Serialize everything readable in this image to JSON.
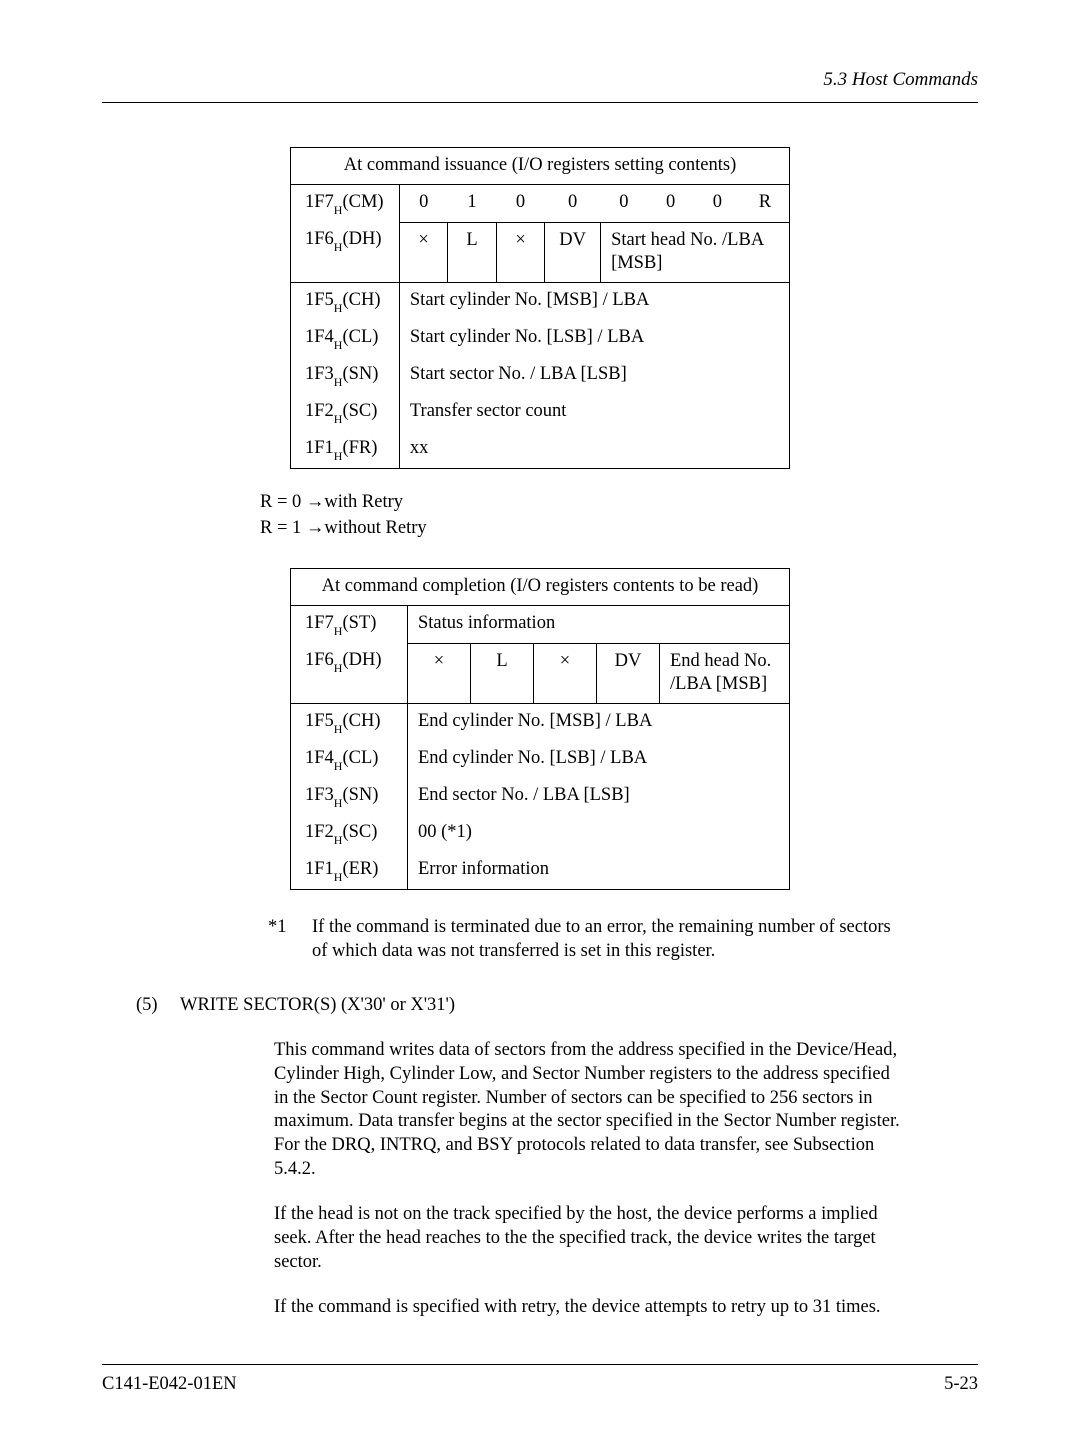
{
  "header": "5.3  Host Commands",
  "table1": {
    "caption": "At command issuance (I/O registers setting contents)",
    "rows": {
      "r1": {
        "reg": "1F7",
        "sub": "H",
        "name": "(CM)",
        "b": [
          "0",
          "1",
          "0",
          "0",
          "0",
          "0",
          "0",
          "R"
        ]
      },
      "r2": {
        "reg": "1F6",
        "sub": "H",
        "name": "(DH)",
        "c1": "×",
        "c2": "L",
        "c3": "×",
        "c4": "DV",
        "c5": "Start head No. /LBA [MSB]"
      },
      "r3": {
        "reg": "1F5",
        "sub": "H",
        "name": "(CH)",
        "val": "Start cylinder No. [MSB] / LBA"
      },
      "r4": {
        "reg": "1F4",
        "sub": "H",
        "name": "(CL)",
        "val": "Start cylinder No. [LSB] / LBA"
      },
      "r5": {
        "reg": "1F3",
        "sub": "H",
        "name": "(SN)",
        "val": "Start sector No. / LBA [LSB]"
      },
      "r6": {
        "reg": "1F2",
        "sub": "H",
        "name": "(SC)",
        "val": "Transfer sector count"
      },
      "r7": {
        "reg": "1F1",
        "sub": "H",
        "name": "(FR)",
        "val": "xx"
      }
    }
  },
  "notes": {
    "line1_a": "R = 0 ",
    "line1_b": "with Retry",
    "line2_a": "R = 1 ",
    "line2_b": "without Retry"
  },
  "table2": {
    "caption": "At command completion (I/O registers contents to be read)",
    "rows": {
      "r1": {
        "reg": "1F7",
        "sub": "H",
        "name": "(ST)",
        "val": "Status information"
      },
      "r2": {
        "reg": "1F6",
        "sub": "H",
        "name": "(DH)",
        "c1": "×",
        "c2": "L",
        "c3": "×",
        "c4": "DV",
        "c5": "End head No. /LBA [MSB]"
      },
      "r3": {
        "reg": "1F5",
        "sub": "H",
        "name": "(CH)",
        "val": "End cylinder No. [MSB] / LBA"
      },
      "r4": {
        "reg": "1F4",
        "sub": "H",
        "name": "(CL)",
        "val": "End cylinder No. [LSB] / LBA"
      },
      "r5": {
        "reg": "1F3",
        "sub": "H",
        "name": "(SN)",
        "val": "End sector No. / LBA [LSB]"
      },
      "r6": {
        "reg": "1F2",
        "sub": "H",
        "name": "(SC)",
        "val": "00 (*1)"
      },
      "r7": {
        "reg": "1F1",
        "sub": "H",
        "name": "(ER)",
        "val": "Error information"
      }
    }
  },
  "footnote": {
    "mark": "*1",
    "text": "If the command is terminated due to an error, the remaining number of sectors of which data was not transferred is set in this register."
  },
  "section": {
    "num": "(5)",
    "title": "WRITE SECTOR(S) (X'30' or X'31')",
    "p1": "This command writes data of sectors from the address specified in the Device/Head, Cylinder High, Cylinder Low, and Sector Number registers to the address specified in the Sector Count register.  Number of sectors can be specified to 256 sectors in maximum.  Data transfer begins at the sector specified in the Sector Number register.  For the DRQ, INTRQ, and BSY protocols related to data transfer, see Subsection 5.4.2.",
    "p2": "If the head is not on the track specified by the host, the device performs a implied seek. After the head reaches to the the specified track, the device writes the target sector.",
    "p3": "If the command is specified with retry, the device attempts to retry up to 31 times."
  },
  "footer": {
    "left": "C141-E042-01EN",
    "right": "5-23"
  },
  "arrow": "→"
}
